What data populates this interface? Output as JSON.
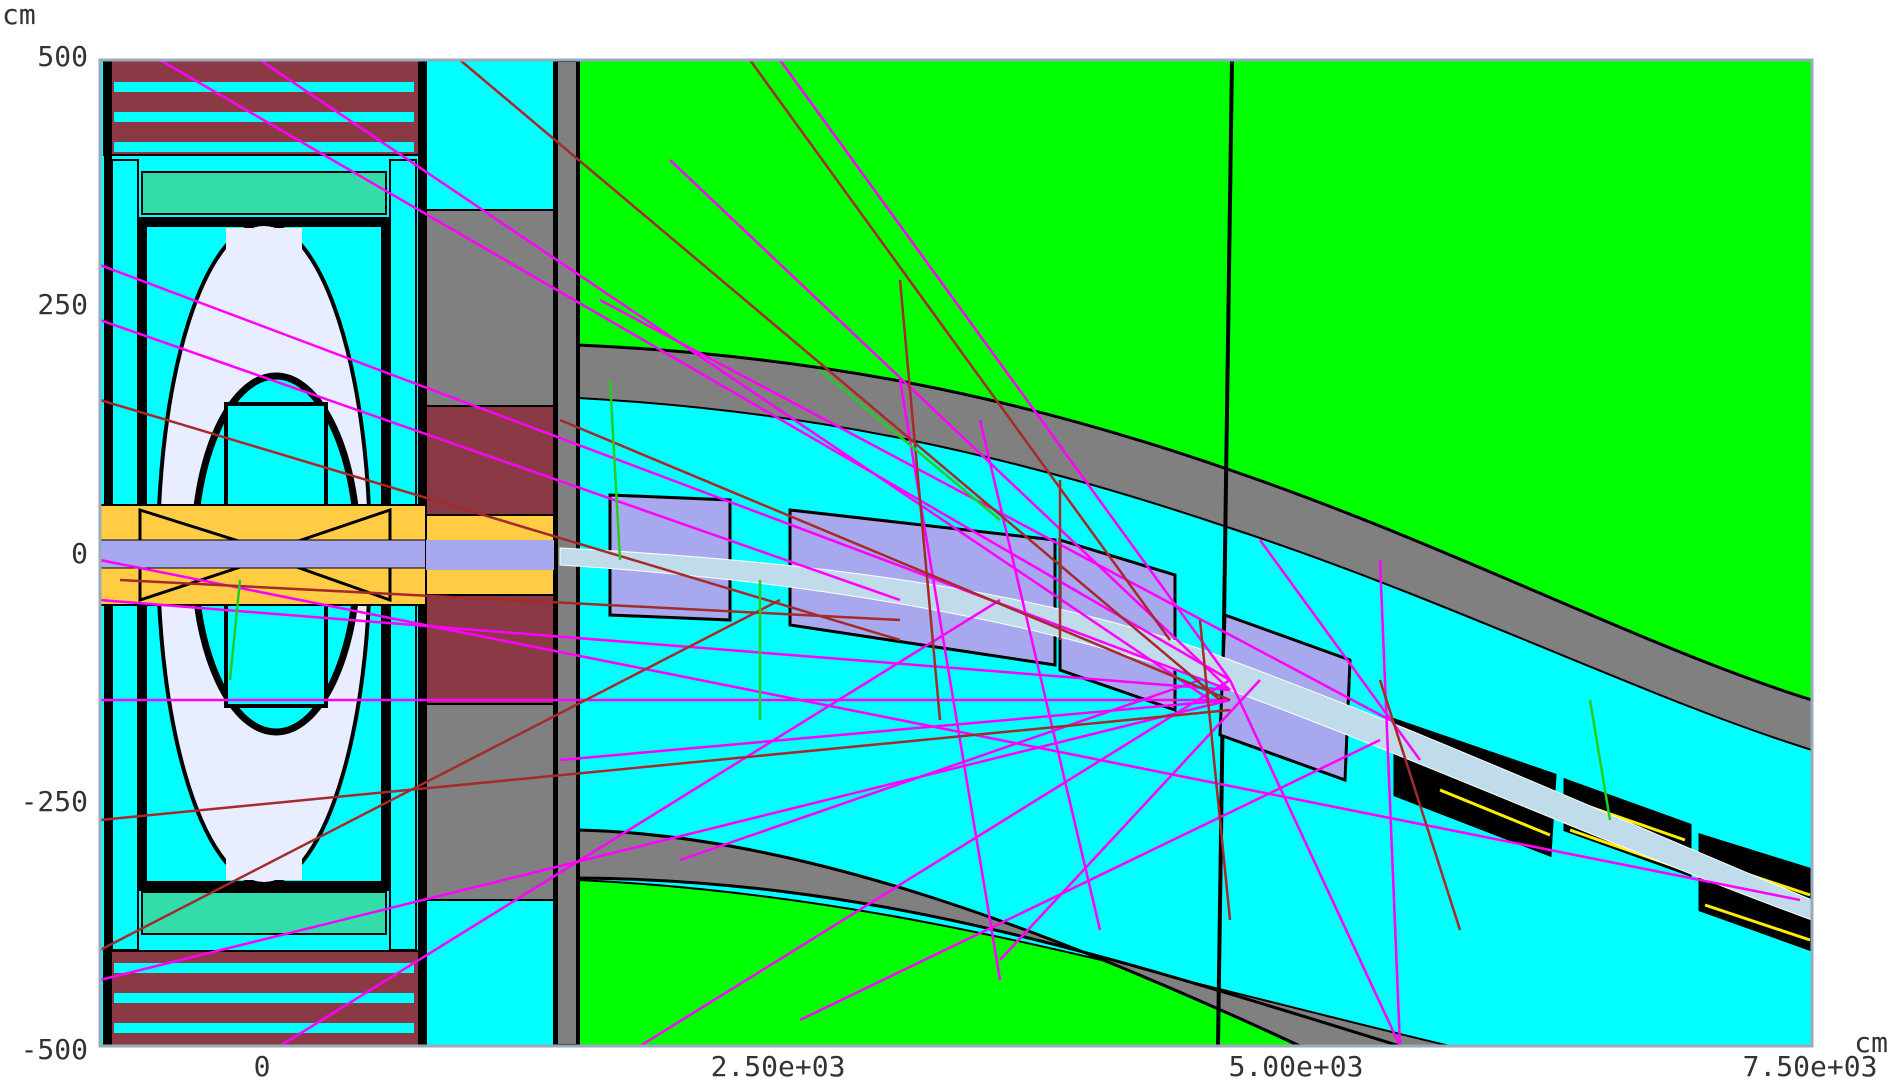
{
  "axes": {
    "y_unit": "cm",
    "x_unit": "cm",
    "y_ticks": [
      "500",
      "250",
      "0",
      "-250",
      "-500"
    ],
    "x_ticks": [
      "0",
      "2.50e+03",
      "5.00e+03",
      "7.50e+03"
    ],
    "x_range": [
      -800,
      7500
    ],
    "y_range": [
      -500,
      500
    ]
  },
  "colors": {
    "background_field": "#00ff00",
    "cyan_region": "#00ffff",
    "gray_absorber": "#808080",
    "maroon_yoke": "#8b3a45",
    "teal_block": "#33ddaa",
    "pale_vessel": "#e8eeff",
    "yellow_pipe": "#ffcc44",
    "lavender_magnet": "#a8a8ee",
    "pink_tracks": "#ff00ff",
    "brown_tracks": "#a52a2a",
    "green_tracks": "#22cc22"
  }
}
